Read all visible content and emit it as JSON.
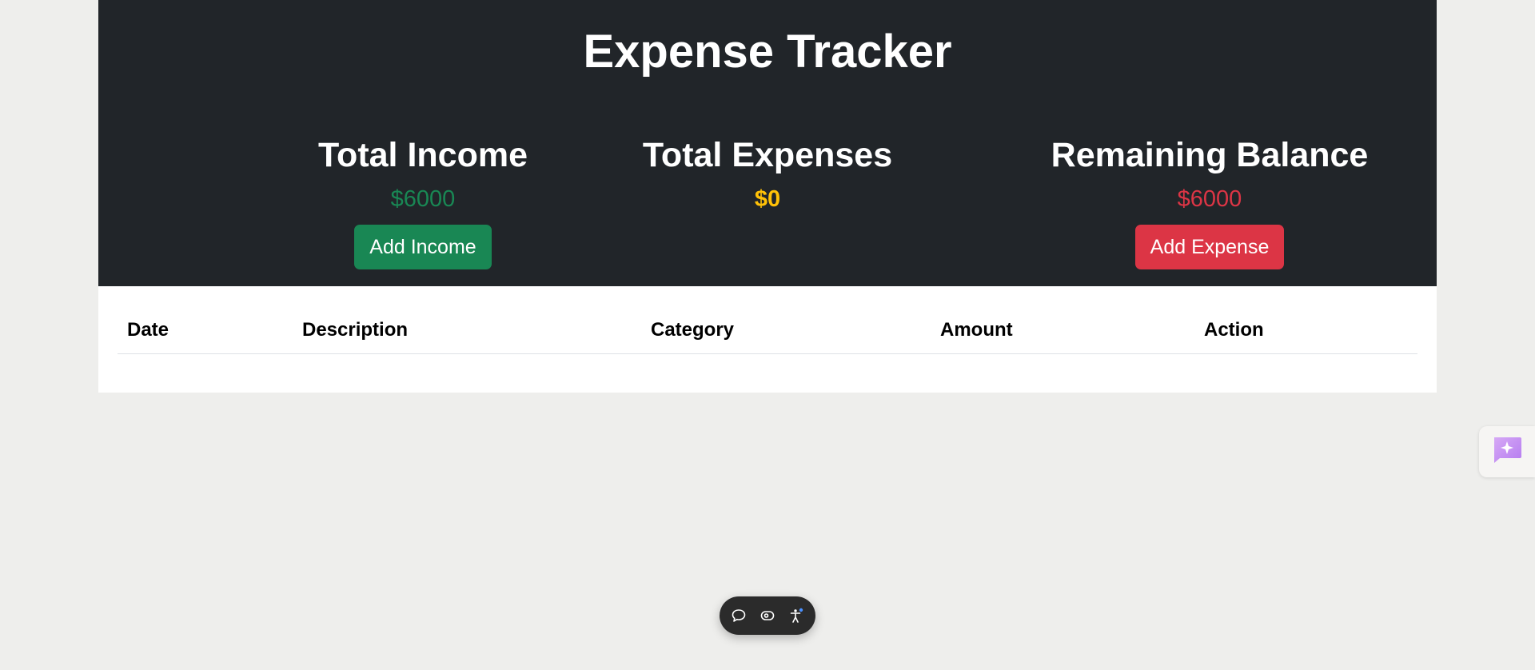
{
  "header": {
    "title": "Expense Tracker"
  },
  "summary": {
    "income": {
      "label": "Total Income",
      "value": "$6000",
      "button": "Add Income",
      "color": "#198754"
    },
    "expenses": {
      "label": "Total Expenses",
      "value": "$0",
      "color": "#ffc107"
    },
    "balance": {
      "label": "Remaining Balance",
      "value": "$6000",
      "button": "Add Expense",
      "color": "#dc3545"
    }
  },
  "table": {
    "columns": [
      "Date",
      "Description",
      "Category",
      "Amount",
      "Action"
    ],
    "rows": []
  },
  "floating": {
    "ai_icon": "sparkle-chat-icon",
    "toolbar_icons": [
      "chat-bubble-icon",
      "eye-icon",
      "accessibility-icon"
    ]
  },
  "colors": {
    "header_bg": "#212529",
    "page_bg": "#eeeeec",
    "ai_accent": "#c08af0"
  }
}
